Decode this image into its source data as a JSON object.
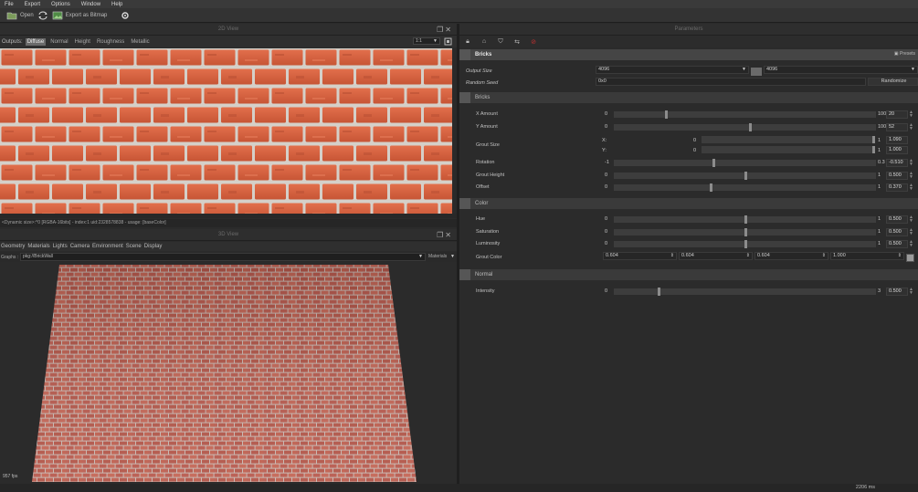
{
  "menu": [
    "File",
    "Export",
    "Options",
    "Window",
    "Help"
  ],
  "toolbar": {
    "open_label": "Open",
    "export_label": "Export as Bitmap"
  },
  "view2d": {
    "title": "2D View",
    "outputs_label": "Outputs:",
    "tabs": [
      "Diffuse",
      "Normal",
      "Height",
      "Roughness",
      "Metallic"
    ],
    "active_tab": "Diffuse",
    "zoom": "1:1",
    "status": "<Dynamic size>:^0 [RGBA-16bits] - index:1 uid:2328578838 - usage: [baseColor]"
  },
  "view3d": {
    "title": "3D View",
    "menu": [
      "Geometry",
      "Materials",
      "Lights",
      "Camera",
      "Environment",
      "Scene",
      "Display"
    ],
    "graphs_label": "Graphs :",
    "graph_path": "pkg://BrickWall",
    "materials_label": "Materials",
    "fps": "957 fps"
  },
  "parameters": {
    "title": "Parameters",
    "header": "Bricks",
    "presets_label": "Presets",
    "output_size_label": "Output Size",
    "output_size_x": "4096",
    "output_size_y": "4096",
    "random_seed_label": "Random Seed",
    "random_seed_value": "0x0",
    "randomize_label": "Randomize",
    "sections": {
      "bricks": "Bricks",
      "color": "Color",
      "normal": "Normal"
    },
    "bricks": {
      "x_amount": {
        "label": "X Amount",
        "min": "0",
        "max": "100",
        "value": "20",
        "level": 0.2
      },
      "y_amount": {
        "label": "Y Amount",
        "min": "0",
        "max": "100",
        "value": "52",
        "level": 0.52
      },
      "grout_size": {
        "label": "Grout Size",
        "x_label": "X:",
        "y_label": "Y:",
        "min_x": "0",
        "min_y": "0",
        "max_x": "1",
        "max_y": "1",
        "value_x": "1.090",
        "value_y": "1.000"
      },
      "rotation": {
        "label": "Rotation",
        "min": "-1",
        "max": "0.3",
        "value": "-0.510",
        "level": 0.38
      },
      "grout_height": {
        "label": "Grout Height",
        "min": "0",
        "max": "1",
        "value": "0.500",
        "level": 0.5
      },
      "offset": {
        "label": "Offset",
        "min": "0",
        "max": "1",
        "value": "0.370",
        "level": 0.37
      }
    },
    "color": {
      "hue": {
        "label": "Hue",
        "min": "0",
        "max": "1",
        "value": "0.500",
        "level": 0.5
      },
      "saturation": {
        "label": "Saturation",
        "min": "0",
        "max": "1",
        "value": "0.500",
        "level": 0.5
      },
      "luminosity": {
        "label": "Luminosity",
        "min": "0",
        "max": "1",
        "value": "0.500",
        "level": 0.5
      },
      "grout_color": {
        "label": "Grout Color",
        "r": "0.604",
        "g": "0.604",
        "b": "0.604",
        "a": "1.000",
        "swatch": "#9a9a9a"
      }
    },
    "normal": {
      "intensity": {
        "label": "Intensity",
        "min": "0",
        "max": "3",
        "value": "0.500",
        "level": 0.17
      }
    }
  },
  "status_bar": {
    "time": "2206 ms"
  },
  "colors": {
    "brick": "#d8603e",
    "mortar": "#d6d2cc",
    "brick3d": "#b85a4e"
  }
}
